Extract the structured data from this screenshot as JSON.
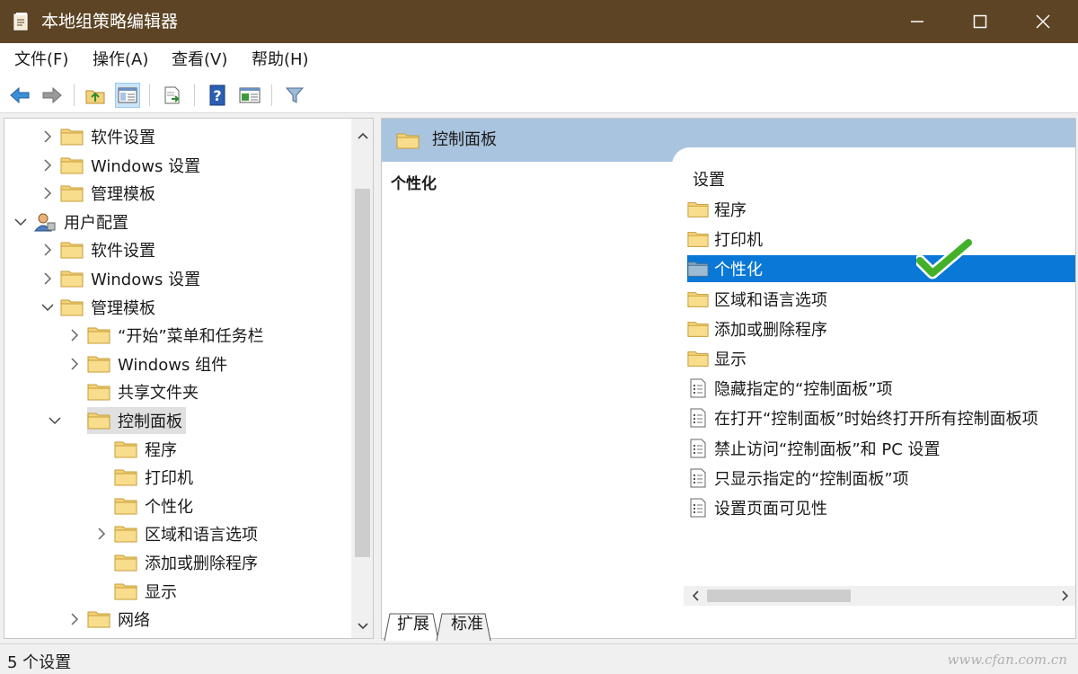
{
  "window": {
    "title": "本地组策略编辑器"
  },
  "menu": [
    "文件(F)",
    "操作(A)",
    "查看(V)",
    "帮助(H)"
  ],
  "toolbar": {
    "buttons": [
      "back-icon",
      "forward-icon",
      "up-folder-icon",
      "show-hide-tree-icon",
      "export-list-icon",
      "help-icon",
      "properties-icon",
      "filter-icon"
    ]
  },
  "tree": {
    "items": [
      {
        "label": "软件设置",
        "icon": "folder-icon",
        "expander": "collapsed"
      },
      {
        "label": "Windows 设置",
        "icon": "folder-icon",
        "expander": "collapsed"
      },
      {
        "label": "管理模板",
        "icon": "folder-icon",
        "expander": "collapsed"
      },
      {
        "label": "用户配置",
        "icon": "user-config-icon",
        "expander": "expanded"
      },
      {
        "label": "软件设置",
        "icon": "folder-icon",
        "expander": "collapsed"
      },
      {
        "label": "Windows 设置",
        "icon": "folder-icon",
        "expander": "collapsed"
      },
      {
        "label": "管理模板",
        "icon": "folder-icon",
        "expander": "expanded"
      },
      {
        "label": "“开始”菜单和任务栏",
        "icon": "folder-icon",
        "expander": "collapsed"
      },
      {
        "label": "Windows 组件",
        "icon": "folder-icon",
        "expander": "collapsed"
      },
      {
        "label": "共享文件夹",
        "icon": "folder-icon",
        "expander": "none"
      },
      {
        "label": "控制面板",
        "icon": "folder-icon",
        "expander": "expanded",
        "selected": true
      },
      {
        "label": "程序",
        "icon": "folder-icon",
        "expander": "none"
      },
      {
        "label": "打印机",
        "icon": "folder-icon",
        "expander": "none"
      },
      {
        "label": "个性化",
        "icon": "folder-icon",
        "expander": "none"
      },
      {
        "label": "区域和语言选项",
        "icon": "folder-icon",
        "expander": "collapsed"
      },
      {
        "label": "添加或删除程序",
        "icon": "folder-icon",
        "expander": "none"
      },
      {
        "label": "显示",
        "icon": "folder-icon",
        "expander": "none"
      },
      {
        "label": "网络",
        "icon": "folder-icon",
        "expander": "collapsed"
      }
    ]
  },
  "details": {
    "header_title": "控制面板",
    "selected_item_title": "个性化",
    "column_header": "设置",
    "items": [
      {
        "label": "程序",
        "icon": "folder-icon"
      },
      {
        "label": "打印机",
        "icon": "folder-icon"
      },
      {
        "label": "个性化",
        "icon": "folder-icon",
        "selected": true
      },
      {
        "label": "区域和语言选项",
        "icon": "folder-icon"
      },
      {
        "label": "添加或删除程序",
        "icon": "folder-icon"
      },
      {
        "label": "显示",
        "icon": "folder-icon"
      },
      {
        "label": "隐藏指定的“控制面板”项",
        "icon": "policy-setting-icon"
      },
      {
        "label": "在打开“控制面板”时始终打开所有控制面板项",
        "icon": "policy-setting-icon"
      },
      {
        "label": "禁止访问“控制面板”和 PC 设置",
        "icon": "policy-setting-icon"
      },
      {
        "label": "只显示指定的“控制面板”项",
        "icon": "policy-setting-icon"
      },
      {
        "label": "设置页面可见性",
        "icon": "policy-setting-icon"
      }
    ]
  },
  "tabs": [
    {
      "label": "扩展",
      "active": true
    },
    {
      "label": "标准",
      "active": false
    }
  ],
  "status": {
    "text": "5 个设置",
    "watermark": "www.cfan.com.cn"
  },
  "colors": {
    "titlebar": "#5c4424",
    "header_band": "#a9c4de",
    "selection": "#0a78d7",
    "folder": "#f3d27a",
    "check": "#43b02a"
  }
}
